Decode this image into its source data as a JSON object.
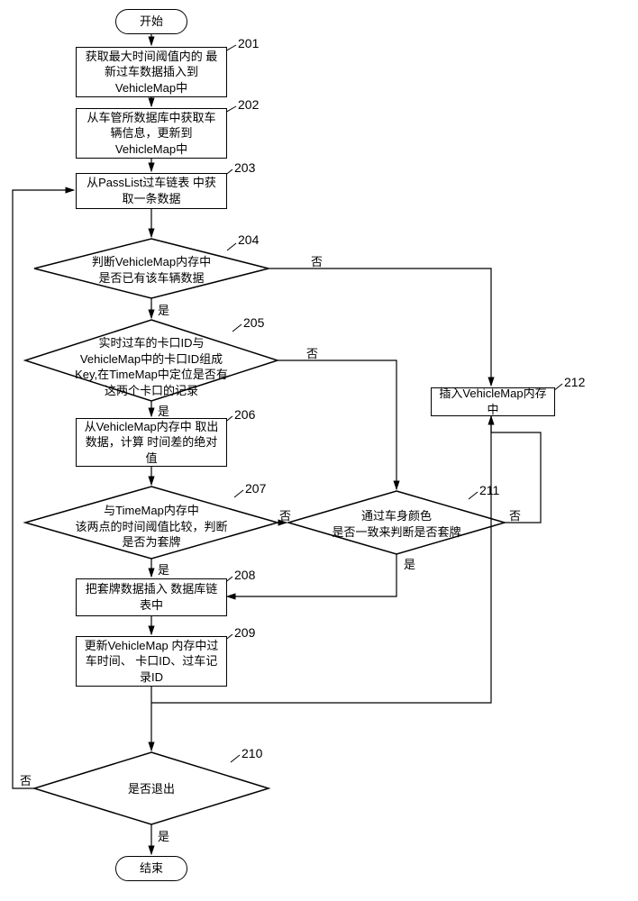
{
  "terminator": {
    "start": "开始",
    "end": "结束"
  },
  "steps": {
    "s201": "获取最大时间阈值内的\n最新过车数据插入到\nVehicleMap中",
    "s202": "从车管所数据库中获取车\n辆信息，更新到\nVehicleMap中",
    "s203": "从PassList过车链表\n中获取一条数据",
    "s206": "从VehicleMap内存中\n取出数据，计算\n时间差的绝对值",
    "s208": "把套牌数据插入\n数据库链表中",
    "s209": "更新VehicleMap\n内存中过车时间、\n卡口ID、过车记录ID",
    "s212": "插入VehicleMap内存中"
  },
  "decisions": {
    "d204": "判断VehicleMap内存中\n是否已有该车辆数据",
    "d205": "实时过车的卡口ID与\nVehicleMap中的卡口ID组成\nKey,在TimeMap中定位是否有\n这两个卡口的记录",
    "d207": "与TimeMap内存中\n该两点的时间阈值比较，判断\n是否为套牌",
    "d210": "是否退出",
    "d211": "通过车身颜色\n是否一致来判断是否套牌"
  },
  "labels": {
    "yes": "是",
    "no": "否"
  },
  "nums": {
    "n201": "201",
    "n202": "202",
    "n203": "203",
    "n204": "204",
    "n205": "205",
    "n206": "206",
    "n207": "207",
    "n208": "208",
    "n209": "209",
    "n210": "210",
    "n211": "211",
    "n212": "212"
  }
}
